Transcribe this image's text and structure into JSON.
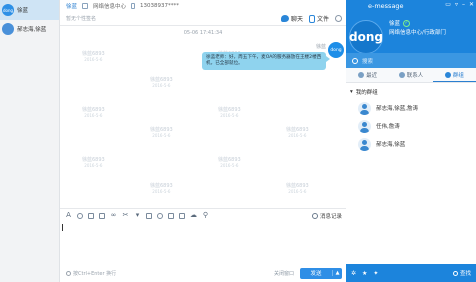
{
  "left_panel": {
    "items": [
      {
        "avatar": "dong",
        "name": "徐蓝"
      },
      {
        "avatar": "",
        "name": "郝志海,徐蓝"
      }
    ]
  },
  "chat": {
    "header": {
      "name": "徐蓝",
      "dept": "网络信息中心",
      "phone": "13038937****"
    },
    "signature_placeholder": "暂无个性签名",
    "tabs": [
      {
        "label": "聊天",
        "icon": "chat-icon"
      },
      {
        "label": "文件",
        "icon": "file-icon"
      }
    ],
    "timestamp": "05-06 17:41:34",
    "message": {
      "sender": "徐蓝",
      "avatar": "dong",
      "text": "徐蓝老师：好，周五下午，麦OA的服务器放在王楼2楼西机，已全部就位。"
    },
    "watermark": {
      "line1": "徐蓝6893",
      "line2": "2016-5-6"
    },
    "history_label": "消息记录",
    "input_hint": "按Ctrl+Enter 换行",
    "close_label": "关闭窗口",
    "send_label": "发送"
  },
  "right_panel": {
    "title": "e-message",
    "avatar_text": "dong",
    "user_name": "徐蓝",
    "department": "网络信息中心/行政部门",
    "search_placeholder": "搜索",
    "tabs": [
      "最近",
      "联系人",
      "群组"
    ],
    "group_title": "我的群组",
    "groups": [
      "郝志海,徐蓝,詹涛",
      "任伟,詹涛",
      "郝志海,徐蓝"
    ],
    "find_label": "查找"
  },
  "colors": {
    "accent": "#1c84dc",
    "bubble": "#8fd3ee",
    "send_button": "#2f8ee6"
  }
}
